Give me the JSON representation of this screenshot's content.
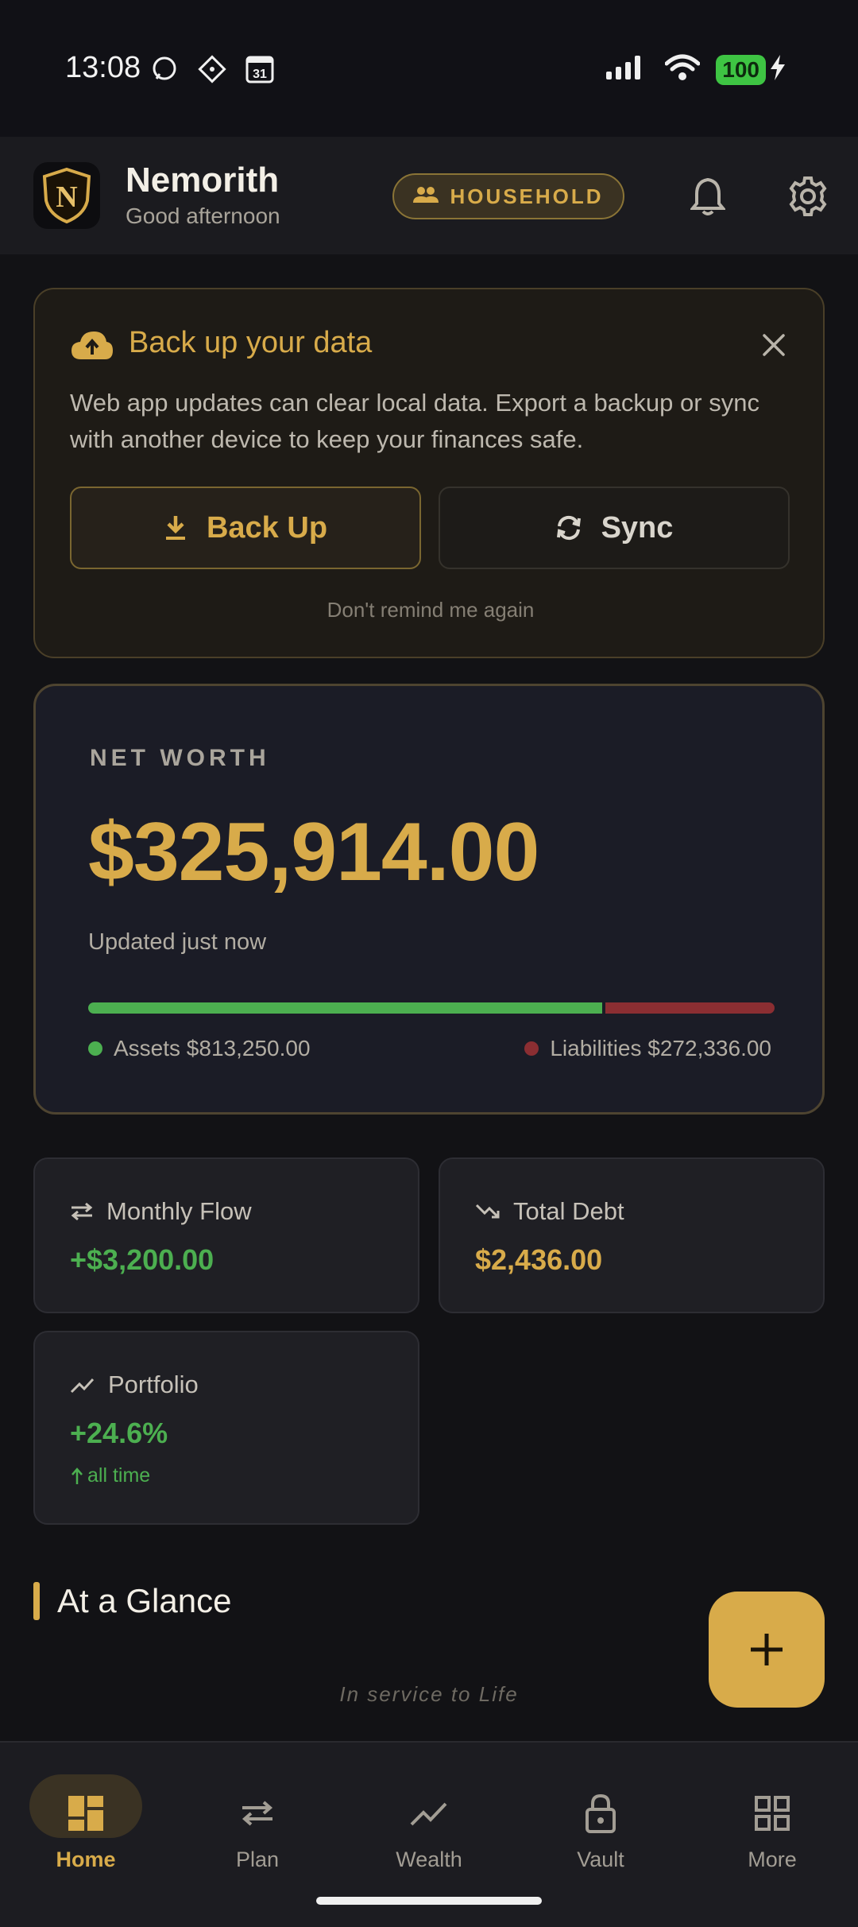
{
  "status_bar": {
    "time": "13:08",
    "calendar_day": "31",
    "battery": "100"
  },
  "header": {
    "app_name": "Nemorith",
    "greeting": "Good afternoon",
    "household_label": "HOUSEHOLD",
    "logo_letter": "N"
  },
  "backup_card": {
    "title": "Back up your data",
    "message": "Web app updates can clear local data. Export a backup or sync with another device to keep your finances safe.",
    "backup_button": "Back Up",
    "sync_button": "Sync",
    "dismiss_link": "Don't remind me again"
  },
  "net_worth": {
    "label": "NET WORTH",
    "value": "$325,914.00",
    "updated": "Updated just now",
    "assets_label": "Assets $813,250.00",
    "liabilities_label": "Liabilities $272,336.00",
    "assets_share": 0.749
  },
  "stats": {
    "monthly_flow": {
      "label": "Monthly Flow",
      "value": "+$3,200.00"
    },
    "total_debt": {
      "label": "Total Debt",
      "value": "$2,436.00"
    },
    "portfolio": {
      "label": "Portfolio",
      "value": "+24.6%",
      "sub": "all time"
    }
  },
  "section": {
    "glance_title": "At a Glance",
    "tagline": "In service to Life"
  },
  "nav": {
    "home": "Home",
    "plan": "Plan",
    "wealth": "Wealth",
    "vault": "Vault",
    "more": "More"
  },
  "colors": {
    "accent": "#d8ab4a",
    "positive": "#4caf50",
    "negative": "#8b2e32",
    "background": "#121215"
  }
}
